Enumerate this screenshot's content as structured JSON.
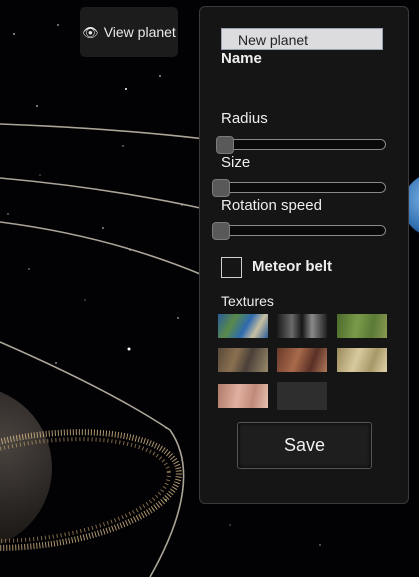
{
  "scene": {
    "view_button": {
      "icon": "eye-icon",
      "label": "View planet"
    }
  },
  "panel": {
    "name_input": {
      "value": "New planet"
    },
    "name_label": "Name",
    "radius": {
      "label": "Radius",
      "value": 0.02
    },
    "size": {
      "label": "Size",
      "value": 0.0
    },
    "rotation_speed": {
      "label": "Rotation speed",
      "value": 0.0
    },
    "meteor_belt": {
      "label": "Meteor belt",
      "checked": false
    },
    "textures": {
      "label": "Textures",
      "items": [
        {
          "name": "earth-texture",
          "color": "#3b6aa0"
        },
        {
          "name": "moon-texture",
          "color": "#5a5a5a"
        },
        {
          "name": "green-texture",
          "color": "#5f7d3a"
        },
        {
          "name": "rocky-texture",
          "color": "#6a5a4a"
        },
        {
          "name": "mars-texture",
          "color": "#8a5a44"
        },
        {
          "name": "sand-texture",
          "color": "#b8a878"
        },
        {
          "name": "pink-texture",
          "color": "#c89a8a"
        },
        {
          "name": "dark-texture",
          "color": "#2e2e2e"
        }
      ]
    },
    "save_label": "Save"
  }
}
